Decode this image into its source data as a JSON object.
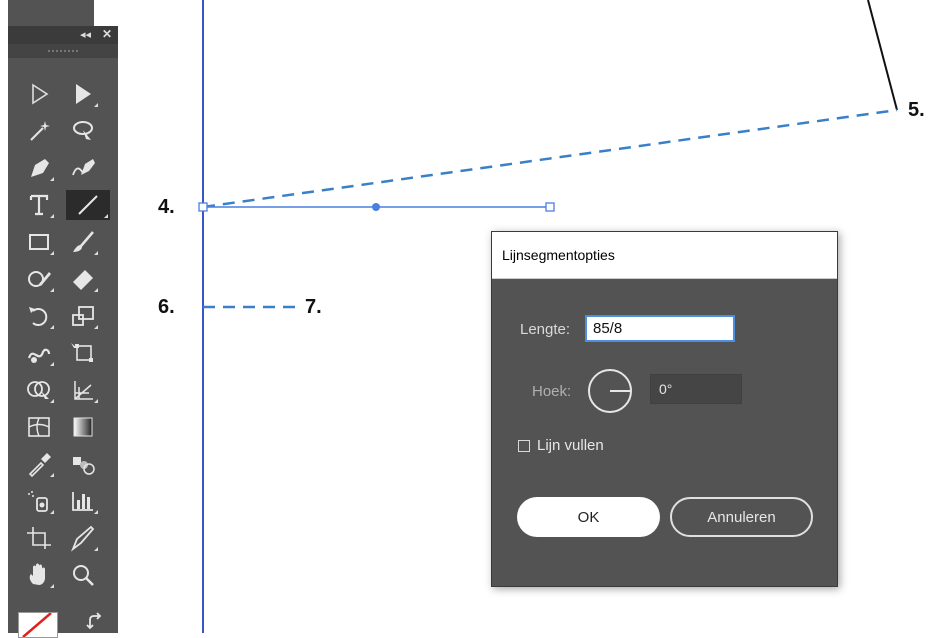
{
  "canvas": {
    "labels": {
      "p4": "4.",
      "p5": "5.",
      "p6": "6.",
      "p7": "7."
    },
    "guide_color": "#3a56c6",
    "dashed_line_color": "#3a80c8",
    "selection_color": "#4a7fe0"
  },
  "tool_panel": {
    "collapse_glyph": "◂◂",
    "close_glyph": "✕",
    "tools": [
      {
        "name": "selection-tool-icon"
      },
      {
        "name": "direct-selection-tool-icon"
      },
      {
        "name": "magic-wand-tool-icon"
      },
      {
        "name": "lasso-tool-icon"
      },
      {
        "name": "pen-tool-icon"
      },
      {
        "name": "curvature-tool-icon"
      },
      {
        "name": "type-tool-icon"
      },
      {
        "name": "line-segment-tool-icon",
        "active": true
      },
      {
        "name": "rectangle-tool-icon"
      },
      {
        "name": "paintbrush-tool-icon"
      },
      {
        "name": "shaper-tool-icon"
      },
      {
        "name": "eraser-tool-icon"
      },
      {
        "name": "rotate-tool-icon"
      },
      {
        "name": "scale-tool-icon"
      },
      {
        "name": "warp-tool-icon"
      },
      {
        "name": "free-transform-tool-icon"
      },
      {
        "name": "shape-builder-tool-icon"
      },
      {
        "name": "perspective-grid-tool-icon"
      },
      {
        "name": "mesh-tool-icon"
      },
      {
        "name": "gradient-tool-icon"
      },
      {
        "name": "eyedropper-tool-icon"
      },
      {
        "name": "blend-tool-icon"
      },
      {
        "name": "symbol-sprayer-tool-icon"
      },
      {
        "name": "column-graph-tool-icon"
      },
      {
        "name": "artboard-tool-icon"
      },
      {
        "name": "slice-tool-icon"
      },
      {
        "name": "hand-tool-icon"
      },
      {
        "name": "zoom-tool-icon"
      }
    ]
  },
  "dialog": {
    "title": "Lijnsegmentopties",
    "length_label": "Lengte:",
    "length_value": "85/8",
    "angle_label": "Hoek:",
    "angle_value": "0°",
    "fill_label": "Lijn vullen",
    "fill_checked": false,
    "ok_label": "OK",
    "cancel_label": "Annuleren"
  }
}
